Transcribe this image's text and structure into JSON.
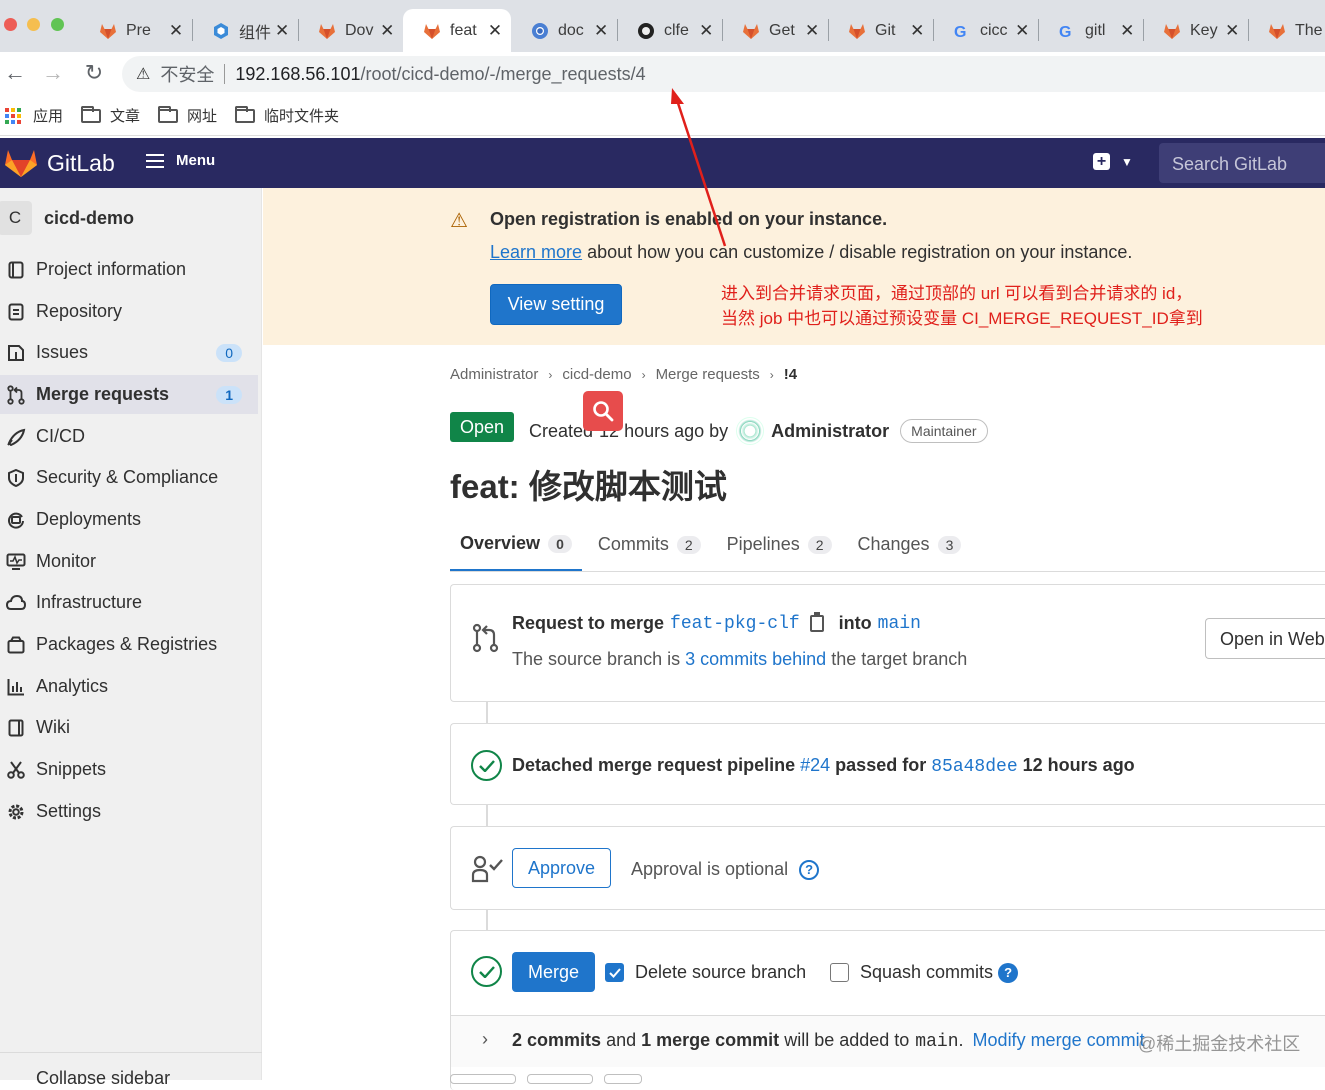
{
  "browser": {
    "tabs": [
      {
        "label": "Pre",
        "icon": "gitlab-fox-icon"
      },
      {
        "label": "组件",
        "icon": "blue-hex-icon"
      },
      {
        "label": "Dov",
        "icon": "gitlab-fox-icon"
      },
      {
        "label": "feat",
        "icon": "gitlab-fox-icon",
        "active": true
      },
      {
        "label": "doc",
        "icon": "chrome-icon"
      },
      {
        "label": "clfe",
        "icon": "github-icon"
      },
      {
        "label": "Get",
        "icon": "gitlab-fox-icon"
      },
      {
        "label": "Git",
        "icon": "gitlab-fox-icon"
      },
      {
        "label": "cicc",
        "icon": "google-icon"
      },
      {
        "label": "gitl",
        "icon": "google-icon"
      },
      {
        "label": "Key",
        "icon": "gitlab-fox-icon"
      },
      {
        "label": "The",
        "icon": "gitlab-fox-icon"
      }
    ],
    "insecure_label": "不安全",
    "url_host": "192.168.56.101",
    "url_path": "/root/cicd-demo/-/merge_requests/4",
    "bookmarks": [
      "应用",
      "文章",
      "网址",
      "临时文件夹"
    ]
  },
  "gitlab_header": {
    "brand": "GitLab",
    "menu_label": "Menu",
    "search_placeholder": "Search GitLab"
  },
  "sidebar": {
    "project_letter": "C",
    "project_name": "cicd-demo",
    "items": [
      {
        "label": "Project information",
        "icon": "info-icon"
      },
      {
        "label": "Repository",
        "icon": "doc-icon"
      },
      {
        "label": "Issues",
        "icon": "issues-icon",
        "count": "0"
      },
      {
        "label": "Merge requests",
        "icon": "merge-request-icon",
        "count": "1",
        "active": true
      },
      {
        "label": "CI/CD",
        "icon": "rocket-icon"
      },
      {
        "label": "Security & Compliance",
        "icon": "shield-icon"
      },
      {
        "label": "Deployments",
        "icon": "deployments-icon"
      },
      {
        "label": "Monitor",
        "icon": "monitor-icon"
      },
      {
        "label": "Infrastructure",
        "icon": "cloud-icon"
      },
      {
        "label": "Packages & Registries",
        "icon": "package-icon"
      },
      {
        "label": "Analytics",
        "icon": "chart-icon"
      },
      {
        "label": "Wiki",
        "icon": "book-icon"
      },
      {
        "label": "Snippets",
        "icon": "scissors-icon"
      },
      {
        "label": "Settings",
        "icon": "gear-icon"
      }
    ],
    "collapse_label": "Collapse sidebar"
  },
  "banner": {
    "title": "Open registration is enabled on your instance.",
    "learn_more": "Learn more",
    "body_rest": "about how you can customize / disable registration on your instance.",
    "button": "View setting"
  },
  "annotation": {
    "line1": "进入到合并请求页面，通过顶部的 url 可以看到合并请求的 id，",
    "line2": "当然 job 中也可以通过预设变量 CI_MERGE_REQUEST_ID拿到",
    "color": "#e0201b"
  },
  "breadcrumb": [
    "Administrator",
    "cicd-demo",
    "Merge requests",
    "!4"
  ],
  "mr": {
    "status": "Open",
    "created_prefix": "Created",
    "created_time": "12 hours ago by",
    "author": "Administrator",
    "role": "Maintainer",
    "title": "feat: 修改脚本测试",
    "tabs": [
      {
        "label": "Overview",
        "count": "0",
        "active": true
      },
      {
        "label": "Commits",
        "count": "2"
      },
      {
        "label": "Pipelines",
        "count": "2"
      },
      {
        "label": "Changes",
        "count": "3"
      }
    ]
  },
  "merge_info": {
    "prefix": "Request to merge",
    "source": "feat-pkg-clf",
    "into": "into",
    "target": "main",
    "behind_prefix": "The source branch is",
    "behind_link": "3 commits behind",
    "behind_suffix": "the target branch",
    "open_button": "Open in Web"
  },
  "pipeline": {
    "prefix": "Detached merge request pipeline",
    "id": "#24",
    "passed_for": "passed for",
    "sha": "85a48dee",
    "time": "12 hours ago"
  },
  "approval": {
    "button": "Approve",
    "text": "Approval is optional"
  },
  "merge": {
    "button": "Merge",
    "delete_branch": "Delete source branch",
    "delete_checked": true,
    "squash": "Squash commits",
    "squash_checked": false
  },
  "commits_summary": {
    "count1": "2 commits",
    "and": "and",
    "count2": "1 merge commit",
    "rest": "will be added to",
    "branch": "main",
    "dot": ".",
    "modify": "Modify merge commit"
  },
  "watermark": "@稀土掘金技术社区",
  "colors": {
    "gitlab_nav": "#292961",
    "link": "#1f75cb",
    "success": "#108548",
    "primary_button": "#1f75cb",
    "banner_bg": "#fdf1dd"
  }
}
